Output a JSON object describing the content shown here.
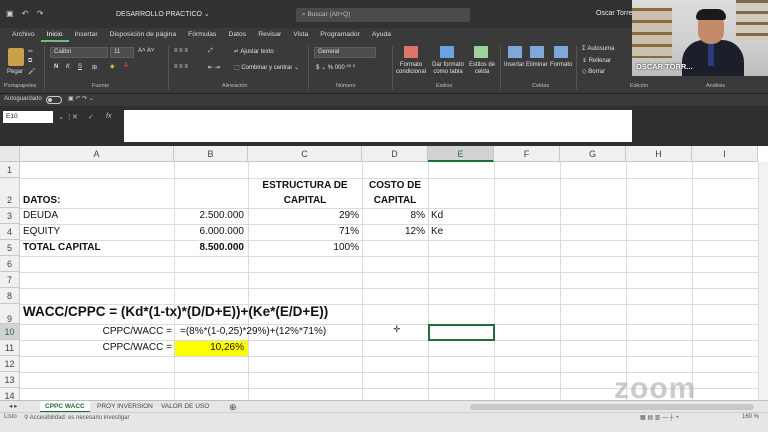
{
  "titlebar": {
    "document": "DESARROLLO PRACTICO ⌄",
    "search_placeholder": "Buscar (Alt+Q)",
    "user": "Oscar Torrez"
  },
  "tabs": [
    "Archivo",
    "Inicio",
    "Insertar",
    "Disposición de página",
    "Fórmulas",
    "Datos",
    "Revisar",
    "Vista",
    "Programador",
    "Ayuda"
  ],
  "active_tab": "Inicio",
  "ribbon": {
    "paste": "Pegar",
    "font_name": "Calibri",
    "font_size": "11",
    "wrap_text": "Ajustar texto",
    "merge": "Combinar y centrar",
    "number_format": "General",
    "conditional": "Formato condicional",
    "table_format": "Dar formato como tabla",
    "cell_styles": "Estilos de celda",
    "insert": "Insertar",
    "delete": "Eliminar",
    "format": "Formato",
    "autosum": "Autosuma",
    "fill": "Rellenar",
    "clear": "Borrar",
    "groups": {
      "clipboard": "Portapapeles",
      "font": "Fuente",
      "alignment": "Alineación",
      "number": "Número",
      "styles": "Estilos",
      "cells": "Celdas",
      "editing": "Edición",
      "analysis": "Análisis"
    }
  },
  "autosave_label": "Autoguardado",
  "namebox": "E10",
  "columns": [
    "A",
    "B",
    "C",
    "D",
    "E",
    "F",
    "G",
    "H",
    "I"
  ],
  "rows": [
    "1",
    "2",
    "3",
    "4",
    "5",
    "6",
    "7",
    "8",
    "9",
    "10",
    "11",
    "12",
    "13",
    "14"
  ],
  "cells": {
    "a2": "DATOS:",
    "c1": "ESTRUCTURA DE",
    "c2": "CAPITAL",
    "d1": "COSTO DE",
    "d2": "CAPITAL",
    "a3": "DEUDA",
    "b3": "2.500.000",
    "c3": "29%",
    "d3": "8%",
    "e3": "Kd",
    "a4": "EQUITY",
    "b4": "6.000.000",
    "c4": "71%",
    "d4": "12%",
    "e4": "Ke",
    "a5": "TOTAL CAPITAL",
    "b5": "8.500.000",
    "c5": "100%",
    "a9": "WACC/CPPC = (Kd*(1-tx)*(D/D+E))+(Ke*(E/D+E))",
    "a10": "CPPC/WACC =",
    "b10": "=(8%*(1-0,25)*29%)+(12%*71%)",
    "a11": "CPPC/WACC =",
    "b11": "10,26%"
  },
  "sheets": [
    "CPPC WACC",
    "PROY INVERSION",
    "VALOR DE USO"
  ],
  "active_sheet": "CPPC WACC",
  "status": {
    "mode": "Listo",
    "accessibility": "Accesibilidad: es necesario investigar",
    "zoom": "160 %"
  },
  "webcam_name": "OSCAR TORR...",
  "watermark": "zoom",
  "colors": {
    "excel_green": "#1e6e3c",
    "highlight": "#ffff00",
    "ribbon_dark": "#3a3a3a"
  }
}
